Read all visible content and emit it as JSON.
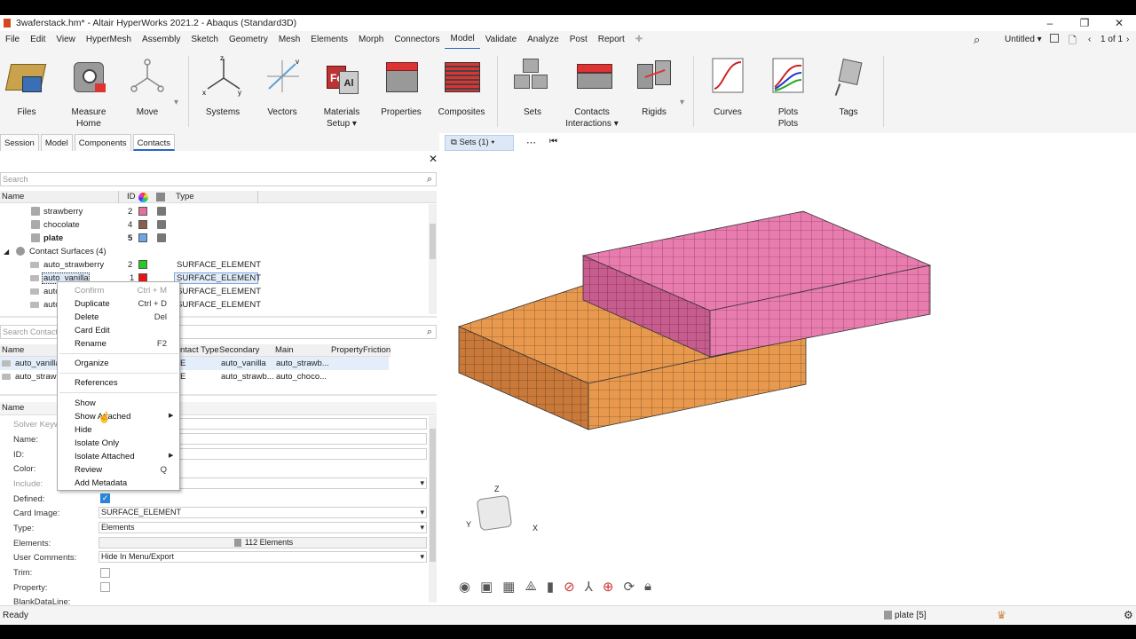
{
  "window": {
    "title": "3waferstack.hm* - Altair HyperWorks 2021.2 - Abaqus (Standard3D)"
  },
  "menu": [
    "File",
    "Edit",
    "View",
    "HyperMesh",
    "Assembly",
    "Sketch",
    "Geometry",
    "Mesh",
    "Elements",
    "Morph",
    "Connectors",
    "Model",
    "Validate",
    "Analyze",
    "Post",
    "Report"
  ],
  "top_right": {
    "session": "Untitled",
    "pages": "1 of 1"
  },
  "ribbon": {
    "files": "Files",
    "measure": "Measure",
    "home": "Home",
    "move": "Move",
    "systems": "Systems",
    "vectors": "Vectors",
    "materials": "Materials",
    "setup": "Setup",
    "properties": "Properties",
    "composites": "Composites",
    "sets": "Sets",
    "contacts": "Contacts",
    "interactions": "Interactions",
    "rigids": "Rigids",
    "curves": "Curves",
    "plots": "Plots",
    "plots2": "Plots",
    "tags": "Tags"
  },
  "tabs": [
    "Session",
    "Model",
    "Components",
    "Contacts"
  ],
  "browser": {
    "search_placeholder": "Search",
    "col_name": "Name",
    "col_id": "ID",
    "col_type": "Type",
    "rows": [
      {
        "name": "strawberry",
        "id": "2",
        "color": "#e6709c",
        "type": ""
      },
      {
        "name": "chocolate",
        "id": "4",
        "color": "#8b5e4c",
        "type": ""
      },
      {
        "name": "plate",
        "id": "5",
        "color": "#6aa6e8",
        "type": ""
      }
    ],
    "group": "Contact Surfaces",
    "group_count": "(4)",
    "surfaces": [
      {
        "name": "auto_strawberry",
        "id": "2",
        "color": "#22cc22",
        "type": "SURFACE_ELEMENT"
      },
      {
        "name": "auto_vanilla",
        "id": "1",
        "color": "#ee1111",
        "type": "SURFACE_ELEMENT"
      },
      {
        "name": "auto",
        "id": "",
        "color": "",
        "type": "SURFACE_ELEMENT"
      },
      {
        "name": "auto",
        "id": "",
        "color": "",
        "type": "SURFACE_ELEMENT"
      }
    ]
  },
  "contact_table": {
    "search_placeholder": "Search Contact",
    "cols": [
      "Name",
      "ntact Type",
      "Secondary",
      "Main",
      "Property",
      "Friction"
    ],
    "rows": [
      {
        "name": "auto_vanilla",
        "type": "E",
        "secondary": "auto_vanilla",
        "main": "auto_strawb..."
      },
      {
        "name": "auto_strawb",
        "type": "E",
        "secondary": "auto_strawb...",
        "main": "auto_choco..."
      }
    ]
  },
  "context_menu": [
    {
      "label": "Confirm",
      "shortcut": "Ctrl + M",
      "disabled": true
    },
    {
      "label": "Duplicate",
      "shortcut": "Ctrl + D"
    },
    {
      "label": "Delete",
      "shortcut": "Del"
    },
    {
      "label": "Card Edit",
      "shortcut": ""
    },
    {
      "label": "Rename",
      "shortcut": "F2"
    },
    {
      "label": "Organize",
      "shortcut": ""
    },
    {
      "label": "References",
      "shortcut": ""
    },
    {
      "label": "Show",
      "shortcut": ""
    },
    {
      "label": "Show Attached",
      "shortcut": ""
    },
    {
      "label": "Hide",
      "shortcut": ""
    },
    {
      "label": "Isolate Only",
      "shortcut": ""
    },
    {
      "label": "Isolate Attached",
      "shortcut": ""
    },
    {
      "label": "Review",
      "shortcut": "Q"
    },
    {
      "label": "Add Metadata",
      "shortcut": ""
    }
  ],
  "entity_editor": {
    "header": "Name",
    "labels": [
      "Solver Keyw",
      "Name:",
      "ID:",
      "Color:",
      "Include:",
      "Defined:",
      "Card Image:",
      "Type:",
      "Elements:",
      "User Comments:",
      "Trim:",
      "Property:",
      "BlankDataLine:"
    ],
    "card_image": "SURFACE_ELEMENT",
    "type": "Elements",
    "elements": "112 Elements",
    "user_comments": "Hide In Menu/Export"
  },
  "viewport": {
    "sets_button": "Sets (1)",
    "triad": {
      "z": "Z",
      "y": "Y",
      "x": "X"
    }
  },
  "status": {
    "left": "Ready",
    "component": "plate [5]"
  },
  "colors": {
    "strawberry": "#e87cae",
    "chocolate": "#e8994e",
    "accent": "#2a64c8"
  }
}
